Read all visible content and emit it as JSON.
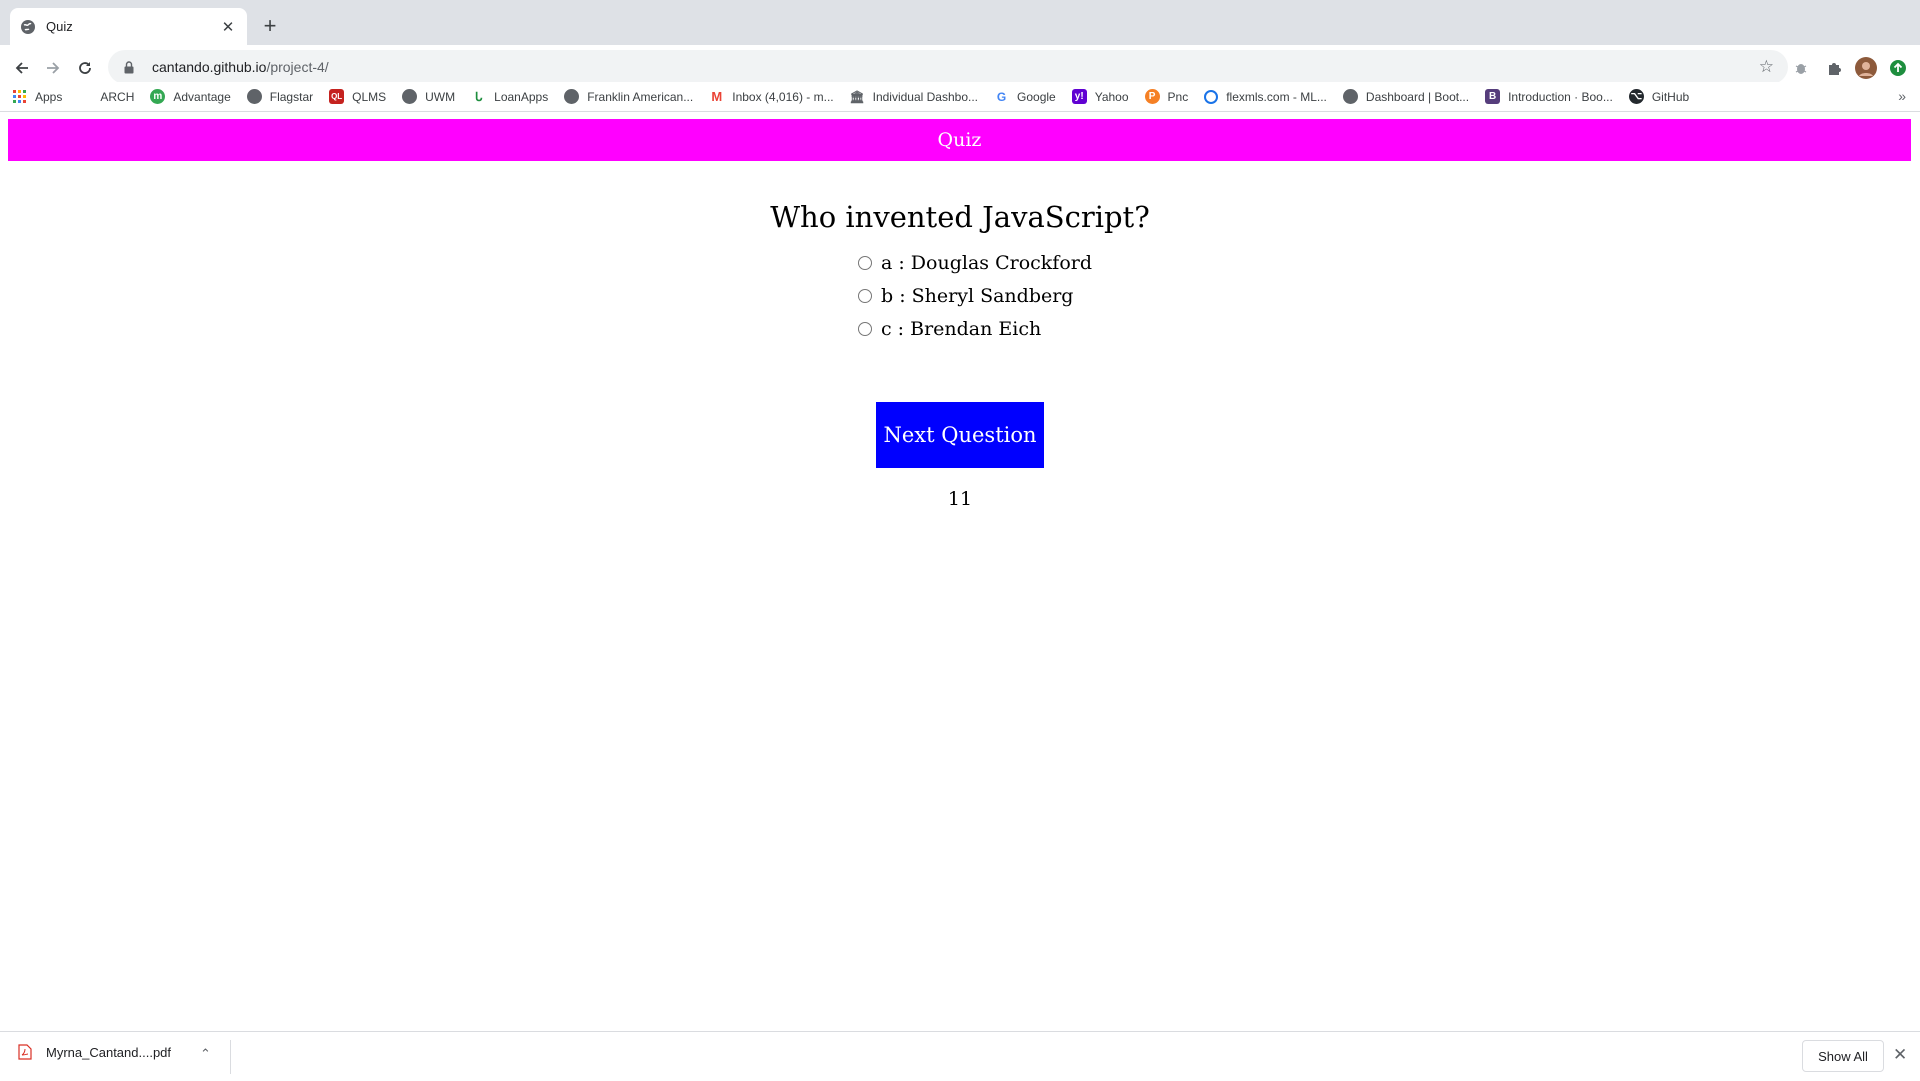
{
  "browser": {
    "tab_title": "Quiz",
    "url_host": "cantando.github.io",
    "url_path": "/project-4/",
    "bookmarks": [
      {
        "label": "Apps",
        "icon": "apps-grid-icon",
        "color": "#ea4335"
      },
      {
        "label": "ARCH",
        "icon": "none",
        "color": "#ffffff"
      },
      {
        "label": "Advantage",
        "icon": "advantage-icon",
        "color": "#34a853"
      },
      {
        "label": "Flagstar",
        "icon": "globe-icon",
        "color": "#5f6368"
      },
      {
        "label": "QLMS",
        "icon": "qlms-icon",
        "color": "#c5221f"
      },
      {
        "label": "UWM",
        "icon": "globe-icon",
        "color": "#5f6368"
      },
      {
        "label": "LoanApps",
        "icon": "loanapps-icon",
        "color": "#1e8e3e"
      },
      {
        "label": "Franklin American...",
        "icon": "globe-icon",
        "color": "#5f6368"
      },
      {
        "label": "Inbox (4,016) - m...",
        "icon": "gmail-icon",
        "color": "#ea4335"
      },
      {
        "label": "Individual Dashbo...",
        "icon": "bank-icon",
        "color": "#5f6368"
      },
      {
        "label": "Google",
        "icon": "google-icon",
        "color": "#4285f4"
      },
      {
        "label": "Yahoo",
        "icon": "yahoo-icon",
        "color": "#6001d2"
      },
      {
        "label": "Pnc",
        "icon": "pnc-icon",
        "color": "#f58025"
      },
      {
        "label": "flexmls.com - ML...",
        "icon": "flexmls-icon",
        "color": "#1a73e8"
      },
      {
        "label": "Dashboard | Boot...",
        "icon": "globe-icon",
        "color": "#5f6368"
      },
      {
        "label": "Introduction · Boo...",
        "icon": "bootstrap-icon",
        "color": "#563d7c"
      },
      {
        "label": "GitHub",
        "icon": "github-icon",
        "color": "#24292e"
      }
    ]
  },
  "quiz": {
    "header": "Quiz",
    "question": "Who invented JavaScript?",
    "options": [
      {
        "key": "a",
        "text": "a : Douglas Crockford"
      },
      {
        "key": "b",
        "text": "b : Sheryl Sandberg"
      },
      {
        "key": "c",
        "text": "c : Brendan Eich"
      }
    ],
    "next_label": "Next Question",
    "score": "11",
    "header_color": "#ff00ff",
    "button_color": "#0000ff"
  },
  "downloads": {
    "file_name": "Myrna_Cantand....pdf",
    "show_all": "Show All"
  }
}
